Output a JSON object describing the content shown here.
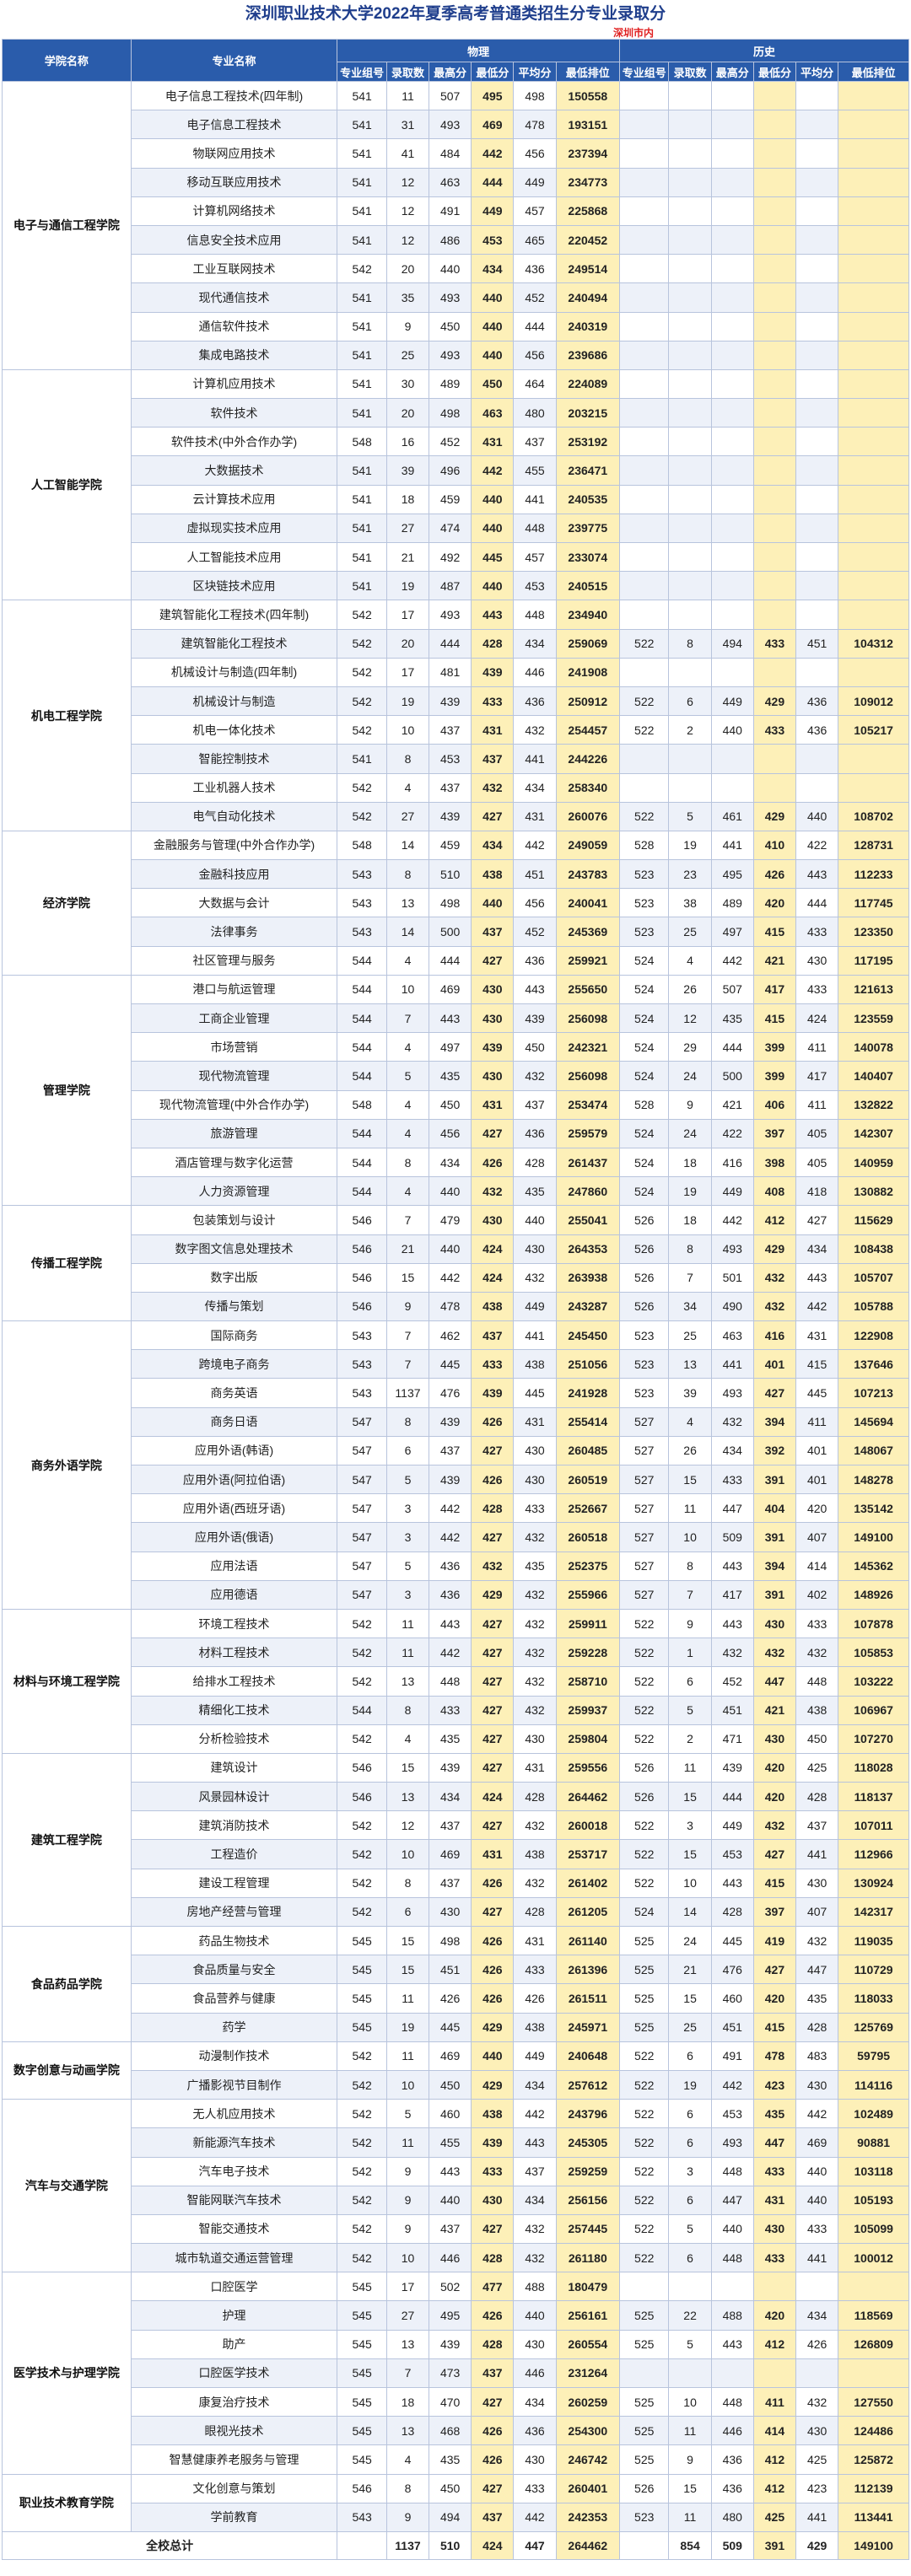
{
  "title": "深圳职业技术大学2022年夏季高考普通类招生分专业录取分",
  "subtitle": "深圳市内",
  "headers": {
    "college": "学院名称",
    "major": "专业名称",
    "physics": "物理",
    "history": "历史",
    "cols": [
      "专业组号",
      "录取数",
      "最高分",
      "最低分",
      "平均分",
      "最低排位"
    ]
  },
  "colleges": [
    {
      "name": "电子与通信工程学院",
      "rows": [
        [
          "电子信息工程技术(四年制)",
          "541",
          "11",
          "507",
          "495",
          "498",
          "150558"
        ],
        [
          "电子信息工程技术",
          "541",
          "31",
          "493",
          "469",
          "478",
          "193151"
        ],
        [
          "物联网应用技术",
          "541",
          "41",
          "484",
          "442",
          "456",
          "237394"
        ],
        [
          "移动互联应用技术",
          "541",
          "12",
          "463",
          "444",
          "449",
          "234773"
        ],
        [
          "计算机网络技术",
          "541",
          "12",
          "491",
          "449",
          "457",
          "225868"
        ],
        [
          "信息安全技术应用",
          "541",
          "12",
          "486",
          "453",
          "465",
          "220452"
        ],
        [
          "工业互联网技术",
          "542",
          "20",
          "440",
          "434",
          "436",
          "249514"
        ],
        [
          "现代通信技术",
          "541",
          "35",
          "493",
          "440",
          "452",
          "240494"
        ],
        [
          "通信软件技术",
          "541",
          "9",
          "450",
          "440",
          "444",
          "240319"
        ],
        [
          "集成电路技术",
          "541",
          "25",
          "493",
          "440",
          "456",
          "239686"
        ]
      ]
    },
    {
      "name": "人工智能学院",
      "rows": [
        [
          "计算机应用技术",
          "541",
          "30",
          "489",
          "450",
          "464",
          "224089"
        ],
        [
          "软件技术",
          "541",
          "20",
          "498",
          "463",
          "480",
          "203215"
        ],
        [
          "软件技术(中外合作办学)",
          "548",
          "16",
          "452",
          "431",
          "437",
          "253192"
        ],
        [
          "大数据技术",
          "541",
          "39",
          "496",
          "442",
          "455",
          "236471"
        ],
        [
          "云计算技术应用",
          "541",
          "18",
          "459",
          "440",
          "441",
          "240535"
        ],
        [
          "虚拟现实技术应用",
          "541",
          "27",
          "474",
          "440",
          "448",
          "239775"
        ],
        [
          "人工智能技术应用",
          "541",
          "21",
          "492",
          "445",
          "457",
          "233074"
        ],
        [
          "区块链技术应用",
          "541",
          "19",
          "487",
          "440",
          "453",
          "240515"
        ]
      ]
    },
    {
      "name": "机电工程学院",
      "rows": [
        [
          "建筑智能化工程技术(四年制)",
          "542",
          "17",
          "493",
          "443",
          "448",
          "234940"
        ],
        [
          "建筑智能化工程技术",
          "542",
          "20",
          "444",
          "428",
          "434",
          "259069",
          "522",
          "8",
          "494",
          "433",
          "451",
          "104312"
        ],
        [
          "机械设计与制造(四年制)",
          "542",
          "17",
          "481",
          "439",
          "446",
          "241908"
        ],
        [
          "机械设计与制造",
          "542",
          "19",
          "439",
          "433",
          "436",
          "250912",
          "522",
          "6",
          "449",
          "429",
          "436",
          "109012"
        ],
        [
          "机电一体化技术",
          "542",
          "10",
          "437",
          "431",
          "432",
          "254457",
          "522",
          "2",
          "440",
          "433",
          "436",
          "105217"
        ],
        [
          "智能控制技术",
          "541",
          "8",
          "453",
          "437",
          "441",
          "244226"
        ],
        [
          "工业机器人技术",
          "542",
          "4",
          "437",
          "432",
          "434",
          "258340"
        ],
        [
          "电气自动化技术",
          "542",
          "27",
          "439",
          "427",
          "431",
          "260076",
          "522",
          "5",
          "461",
          "429",
          "440",
          "108702"
        ]
      ]
    },
    {
      "name": "经济学院",
      "rows": [
        [
          "金融服务与管理(中外合作办学)",
          "548",
          "14",
          "459",
          "434",
          "442",
          "249059",
          "528",
          "19",
          "441",
          "410",
          "422",
          "128731"
        ],
        [
          "金融科技应用",
          "543",
          "8",
          "510",
          "438",
          "451",
          "243783",
          "523",
          "23",
          "495",
          "426",
          "443",
          "112233"
        ],
        [
          "大数据与会计",
          "543",
          "13",
          "498",
          "440",
          "456",
          "240041",
          "523",
          "38",
          "489",
          "420",
          "444",
          "117745"
        ],
        [
          "法律事务",
          "543",
          "14",
          "500",
          "437",
          "452",
          "245369",
          "523",
          "25",
          "497",
          "415",
          "433",
          "123350"
        ],
        [
          "社区管理与服务",
          "544",
          "4",
          "444",
          "427",
          "436",
          "259921",
          "524",
          "4",
          "442",
          "421",
          "430",
          "117195"
        ]
      ]
    },
    {
      "name": "管理学院",
      "rows": [
        [
          "港口与航运管理",
          "544",
          "10",
          "469",
          "430",
          "443",
          "255650",
          "524",
          "26",
          "507",
          "417",
          "433",
          "121613"
        ],
        [
          "工商企业管理",
          "544",
          "7",
          "443",
          "430",
          "439",
          "256098",
          "524",
          "12",
          "435",
          "415",
          "424",
          "123559"
        ],
        [
          "市场营销",
          "544",
          "4",
          "497",
          "439",
          "450",
          "242321",
          "524",
          "29",
          "444",
          "399",
          "411",
          "140078"
        ],
        [
          "现代物流管理",
          "544",
          "5",
          "435",
          "430",
          "432",
          "256098",
          "524",
          "24",
          "500",
          "399",
          "417",
          "140407"
        ],
        [
          "现代物流管理(中外合作办学)",
          "548",
          "4",
          "450",
          "431",
          "437",
          "253474",
          "528",
          "9",
          "421",
          "406",
          "411",
          "132822"
        ],
        [
          "旅游管理",
          "544",
          "4",
          "456",
          "427",
          "436",
          "259579",
          "524",
          "24",
          "422",
          "397",
          "405",
          "142307"
        ],
        [
          "酒店管理与数字化运营",
          "544",
          "8",
          "434",
          "426",
          "428",
          "261437",
          "524",
          "18",
          "416",
          "398",
          "405",
          "140959"
        ],
        [
          "人力资源管理",
          "544",
          "4",
          "440",
          "432",
          "435",
          "247860",
          "524",
          "19",
          "449",
          "408",
          "418",
          "130882"
        ]
      ]
    },
    {
      "name": "传播工程学院",
      "rows": [
        [
          "包装策划与设计",
          "546",
          "7",
          "479",
          "430",
          "440",
          "255041",
          "526",
          "18",
          "442",
          "412",
          "427",
          "115629"
        ],
        [
          "数字图文信息处理技术",
          "546",
          "21",
          "440",
          "424",
          "430",
          "264353",
          "526",
          "8",
          "493",
          "429",
          "434",
          "108438"
        ],
        [
          "数字出版",
          "546",
          "15",
          "442",
          "424",
          "432",
          "263938",
          "526",
          "7",
          "501",
          "432",
          "443",
          "105707"
        ],
        [
          "传播与策划",
          "546",
          "9",
          "478",
          "438",
          "449",
          "243287",
          "526",
          "34",
          "490",
          "432",
          "442",
          "105788"
        ]
      ]
    },
    {
      "name": "商务外语学院",
      "rows": [
        [
          "国际商务",
          "543",
          "7",
          "462",
          "437",
          "441",
          "245450",
          "523",
          "25",
          "463",
          "416",
          "431",
          "122908"
        ],
        [
          "跨境电子商务",
          "543",
          "7",
          "445",
          "433",
          "438",
          "251056",
          "523",
          "13",
          "441",
          "401",
          "415",
          "137646"
        ],
        [
          "商务英语",
          "543",
          "1137",
          "476",
          "439",
          "445",
          "241928",
          "523",
          "39",
          "493",
          "427",
          "445",
          "107213"
        ],
        [
          "商务日语",
          "547",
          "8",
          "439",
          "426",
          "431",
          "255414",
          "527",
          "4",
          "432",
          "394",
          "411",
          "145694"
        ],
        [
          "应用外语(韩语)",
          "547",
          "6",
          "437",
          "427",
          "430",
          "260485",
          "527",
          "26",
          "434",
          "392",
          "401",
          "148067"
        ],
        [
          "应用外语(阿拉伯语)",
          "547",
          "5",
          "439",
          "426",
          "430",
          "260519",
          "527",
          "15",
          "433",
          "391",
          "401",
          "148278"
        ],
        [
          "应用外语(西班牙语)",
          "547",
          "3",
          "442",
          "428",
          "433",
          "252667",
          "527",
          "11",
          "447",
          "404",
          "420",
          "135142"
        ],
        [
          "应用外语(俄语)",
          "547",
          "3",
          "442",
          "427",
          "432",
          "260518",
          "527",
          "10",
          "509",
          "391",
          "407",
          "149100"
        ],
        [
          "应用法语",
          "547",
          "5",
          "436",
          "432",
          "435",
          "252375",
          "527",
          "8",
          "443",
          "394",
          "414",
          "145362"
        ],
        [
          "应用德语",
          "547",
          "3",
          "436",
          "429",
          "432",
          "255966",
          "527",
          "7",
          "417",
          "391",
          "402",
          "148926"
        ]
      ]
    },
    {
      "name": "材料与环境工程学院",
      "rows": [
        [
          "环境工程技术",
          "542",
          "11",
          "443",
          "427",
          "432",
          "259911",
          "522",
          "9",
          "443",
          "430",
          "433",
          "107878"
        ],
        [
          "材料工程技术",
          "542",
          "11",
          "442",
          "427",
          "432",
          "259228",
          "522",
          "1",
          "432",
          "432",
          "432",
          "105853"
        ],
        [
          "给排水工程技术",
          "542",
          "13",
          "448",
          "427",
          "432",
          "258710",
          "522",
          "6",
          "452",
          "447",
          "448",
          "103222"
        ],
        [
          "精细化工技术",
          "544",
          "8",
          "433",
          "427",
          "432",
          "259937",
          "522",
          "5",
          "451",
          "421",
          "438",
          "106967"
        ],
        [
          "分析检验技术",
          "542",
          "4",
          "435",
          "427",
          "430",
          "259804",
          "522",
          "2",
          "471",
          "430",
          "450",
          "107270"
        ]
      ]
    },
    {
      "name": "建筑工程学院",
      "rows": [
        [
          "建筑设计",
          "546",
          "15",
          "439",
          "427",
          "431",
          "259556",
          "526",
          "11",
          "439",
          "420",
          "425",
          "118028"
        ],
        [
          "风景园林设计",
          "546",
          "13",
          "434",
          "424",
          "428",
          "264462",
          "526",
          "15",
          "444",
          "420",
          "428",
          "118137"
        ],
        [
          "建筑消防技术",
          "542",
          "12",
          "437",
          "427",
          "432",
          "260018",
          "522",
          "3",
          "449",
          "432",
          "437",
          "107011"
        ],
        [
          "工程造价",
          "542",
          "10",
          "469",
          "431",
          "438",
          "253717",
          "522",
          "15",
          "453",
          "427",
          "441",
          "112966"
        ],
        [
          "建设工程管理",
          "542",
          "8",
          "437",
          "426",
          "432",
          "261402",
          "522",
          "10",
          "443",
          "415",
          "430",
          "130924"
        ],
        [
          "房地产经营与管理",
          "542",
          "6",
          "430",
          "427",
          "428",
          "261205",
          "524",
          "14",
          "428",
          "397",
          "407",
          "142317"
        ]
      ]
    },
    {
      "name": "食品药品学院",
      "rows": [
        [
          "药品生物技术",
          "545",
          "15",
          "498",
          "426",
          "431",
          "261140",
          "525",
          "24",
          "445",
          "419",
          "432",
          "119035"
        ],
        [
          "食品质量与安全",
          "545",
          "15",
          "451",
          "426",
          "433",
          "261396",
          "525",
          "21",
          "476",
          "427",
          "447",
          "110729"
        ],
        [
          "食品营养与健康",
          "545",
          "11",
          "426",
          "426",
          "426",
          "261511",
          "525",
          "15",
          "460",
          "420",
          "435",
          "118033"
        ],
        [
          "药学",
          "545",
          "19",
          "445",
          "429",
          "438",
          "245971",
          "525",
          "25",
          "451",
          "415",
          "428",
          "125769"
        ]
      ]
    },
    {
      "name": "数字创意与动画学院",
      "rows": [
        [
          "动漫制作技术",
          "542",
          "11",
          "469",
          "440",
          "449",
          "240648",
          "522",
          "6",
          "491",
          "478",
          "483",
          "59795"
        ],
        [
          "广播影视节目制作",
          "542",
          "10",
          "450",
          "429",
          "434",
          "257612",
          "522",
          "19",
          "442",
          "423",
          "430",
          "114116"
        ]
      ]
    },
    {
      "name": "汽车与交通学院",
      "rows": [
        [
          "无人机应用技术",
          "542",
          "5",
          "460",
          "438",
          "442",
          "243796",
          "522",
          "6",
          "453",
          "435",
          "442",
          "102489"
        ],
        [
          "新能源汽车技术",
          "542",
          "11",
          "455",
          "439",
          "443",
          "245305",
          "522",
          "6",
          "493",
          "447",
          "469",
          "90881"
        ],
        [
          "汽车电子技术",
          "542",
          "9",
          "443",
          "433",
          "437",
          "259259",
          "522",
          "3",
          "448",
          "433",
          "440",
          "103118"
        ],
        [
          "智能网联汽车技术",
          "542",
          "9",
          "440",
          "430",
          "434",
          "256156",
          "522",
          "6",
          "447",
          "431",
          "440",
          "105193"
        ],
        [
          "智能交通技术",
          "542",
          "9",
          "437",
          "427",
          "432",
          "257445",
          "522",
          "5",
          "440",
          "430",
          "433",
          "105099"
        ],
        [
          "城市轨道交通运营管理",
          "542",
          "10",
          "446",
          "428",
          "432",
          "261180",
          "522",
          "6",
          "448",
          "433",
          "441",
          "100012"
        ]
      ]
    },
    {
      "name": "医学技术与护理学院",
      "rows": [
        [
          "口腔医学",
          "545",
          "17",
          "502",
          "477",
          "488",
          "180479"
        ],
        [
          "护理",
          "545",
          "27",
          "495",
          "426",
          "440",
          "256161",
          "525",
          "22",
          "488",
          "420",
          "434",
          "118569"
        ],
        [
          "助产",
          "545",
          "13",
          "439",
          "428",
          "430",
          "260554",
          "525",
          "5",
          "443",
          "412",
          "426",
          "126809"
        ],
        [
          "口腔医学技术",
          "545",
          "7",
          "473",
          "437",
          "446",
          "231264"
        ],
        [
          "康复治疗技术",
          "545",
          "18",
          "470",
          "427",
          "434",
          "260259",
          "525",
          "10",
          "448",
          "411",
          "432",
          "127550"
        ],
        [
          "眼视光技术",
          "545",
          "13",
          "468",
          "426",
          "436",
          "254300",
          "525",
          "11",
          "446",
          "414",
          "430",
          "124486"
        ],
        [
          "智慧健康养老服务与管理",
          "545",
          "4",
          "435",
          "426",
          "430",
          "246742",
          "525",
          "9",
          "436",
          "412",
          "425",
          "125872"
        ]
      ]
    },
    {
      "name": "职业技术教育学院",
      "rows": [
        [
          "文化创意与策划",
          "546",
          "8",
          "450",
          "427",
          "433",
          "260401",
          "526",
          "15",
          "436",
          "412",
          "423",
          "112139"
        ],
        [
          "学前教育",
          "543",
          "9",
          "494",
          "437",
          "442",
          "242353",
          "523",
          "11",
          "480",
          "425",
          "441",
          "113441"
        ]
      ]
    }
  ],
  "total": {
    "label": "全校总计",
    "physics": [
      "",
      "1137",
      "510",
      "424",
      "447",
      "264462"
    ],
    "history": [
      "",
      "854",
      "509",
      "391",
      "429",
      "149100"
    ]
  }
}
